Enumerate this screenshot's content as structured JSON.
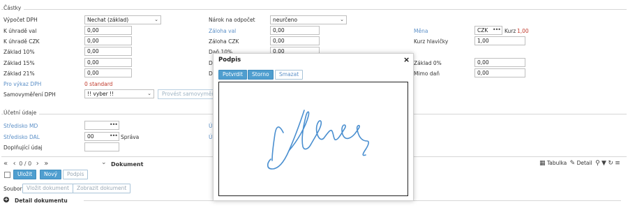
{
  "castky": {
    "section_title": "Částky",
    "vypocet_dph_label": "Výpočet DPH",
    "vypocet_dph_value": "Nechat (základ)",
    "k_uhrade_val_label": "K úhradě val",
    "k_uhrade_val_value": "0,00",
    "k_uhrade_czk_label": "K úhradě CZK",
    "k_uhrade_czk_value": "0,00",
    "zaklad_10_label": "Základ 10%",
    "zaklad_10_value": "0,00",
    "zaklad_15_label": "Základ 15%",
    "zaklad_15_value": "0,00",
    "zaklad_21_label": "Základ 21%",
    "zaklad_21_value": "0,00",
    "pro_vykaz_dph_label": "Pro výkaz DPH",
    "pro_vykaz_dph_value": "0 standard",
    "samovymereni_label": "Samovyměření DPH",
    "samovymereni_value": "!! vyber !!",
    "provest_samovymereni_button": "Provést samovyměření",
    "narok_label": "Nárok na odpočet",
    "narok_value": "neurčeno",
    "zaloha_val_label": "Záloha val",
    "zaloha_val_value": "0,00",
    "zaloha_czk_label": "Záloha CZK",
    "zaloha_czk_value": "0,00",
    "dan_10_label": "Daň 10%",
    "dan_10_value": "0,00",
    "dan_15_label": "D",
    "dan_21_label": "D",
    "mena_label": "Měna",
    "mena_value": "CZK",
    "kurz_label": "Kurz",
    "kurz_value": "1,00",
    "kurz_hlavicky_label": "Kurz hlavičky",
    "kurz_hlavicky_value": "1,00",
    "zaklad_0_label": "Základ 0%",
    "zaklad_0_value": "0,00",
    "mimo_dan_label": "Mimo daň",
    "mimo_dan_value": "0,00"
  },
  "ucetni": {
    "section_title": "Účetní údaje",
    "stredisko_md_label": "Středisko MD",
    "stredisko_md_value": "",
    "stredisko_dal_label": "Středisko DAL",
    "stredisko_dal_value": "00",
    "stredisko_dal_name": "Správa",
    "doplnujici_label": "Doplňující údaj",
    "doplnujici_value": "",
    "trunc_label_1": "Ú",
    "trunc_label_2": "Ú"
  },
  "toolbar": {
    "pager_text": "0 / 0",
    "first_symbol": "«",
    "prev_symbol": "‹",
    "next_symbol": "›",
    "last_symbol": "»",
    "chevron": "⌄",
    "dokument_title": "Dokument",
    "ulozit_button": "Uložit",
    "novy_button": "Nový",
    "podpis_button": "Podpis",
    "soubor_label": "Soubor",
    "vlozit_dokument_button": "Vložit dokument",
    "zobrazit_dokument_button": "Zobrazit dokument",
    "detail_dokumentu_label": "Detail dokumentu",
    "tabulka_label": "Tabulka",
    "detail_label": "Detail"
  },
  "modal": {
    "title": "Podpis",
    "close": "×",
    "potvrdit_button": "Potvrdit",
    "storno_button": "Storno",
    "smazat_button": "Smazat"
  },
  "colors": {
    "accent_blue": "#4f9ecf",
    "link_blue": "#5b8fc7",
    "red_value": "#c0392b",
    "signature_ink": "#4a8fd0"
  }
}
